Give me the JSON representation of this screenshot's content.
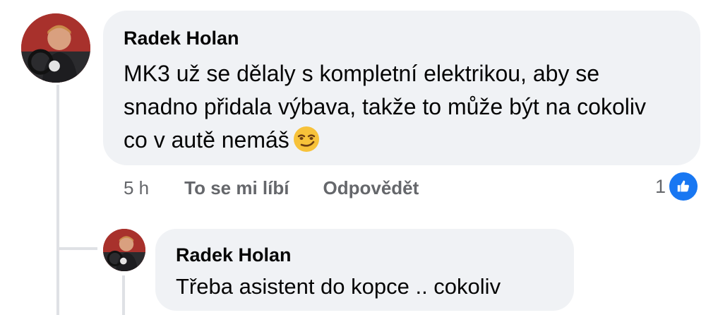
{
  "comment": {
    "author": "Radek Holan",
    "text": "MK3 už se dělaly s kompletní elektrikou, aby se snadno přidala výbava, takže to může být na cokoliv co v autě nemáš",
    "emoji": "smirking-face",
    "time": "5 h",
    "like_label": "To se mi líbí",
    "reply_label": "Odpovědět",
    "reaction_count": "1",
    "reaction_icon": "like-icon"
  },
  "reply": {
    "author": "Radek Holan",
    "text": "Třeba asistent do kopce .. cokoliv"
  },
  "colors": {
    "bubble": "#f0f2f5",
    "text": "#050505",
    "meta": "#65676b",
    "like_blue": "#1877f2",
    "thread_line": "#dfe1e5"
  }
}
